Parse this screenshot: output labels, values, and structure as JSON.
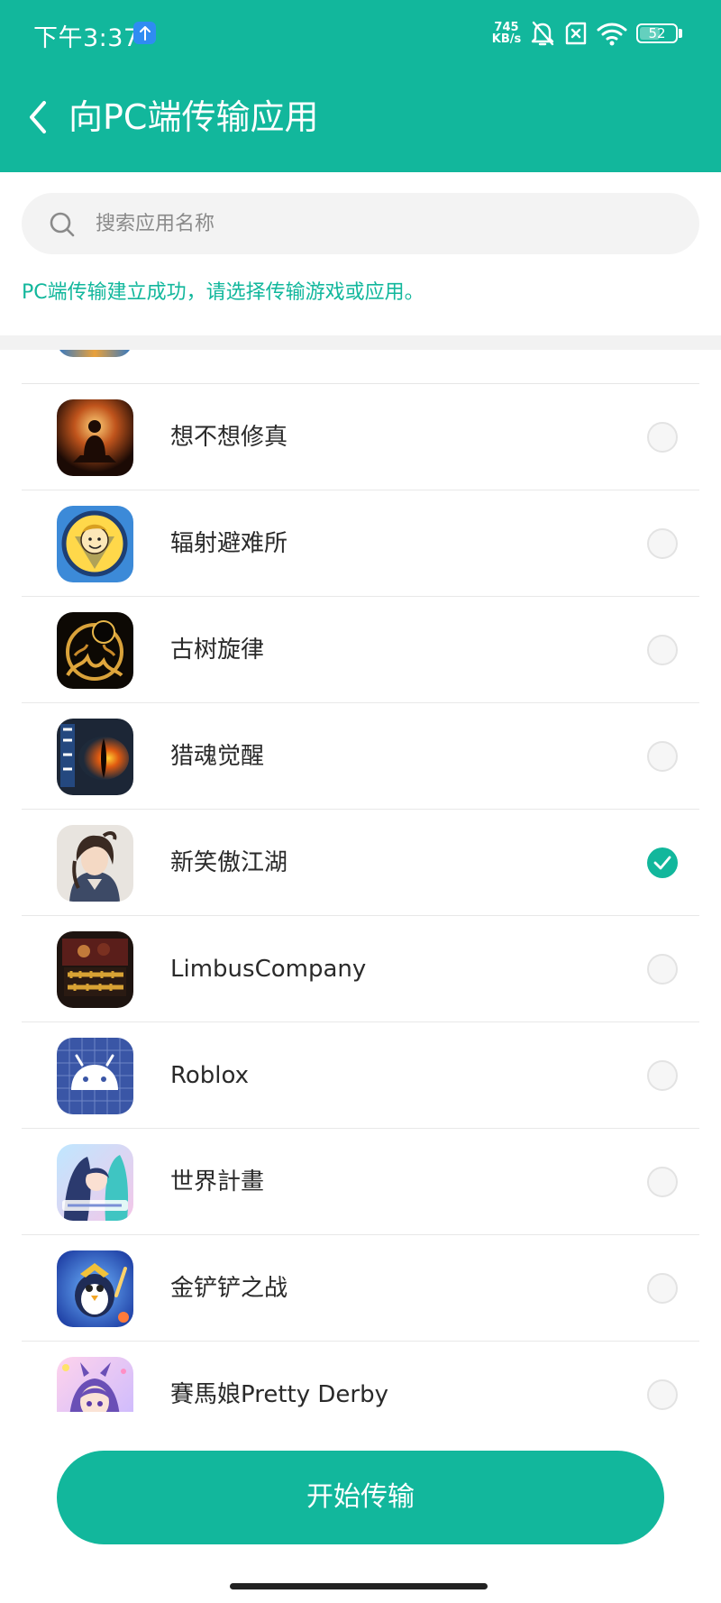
{
  "status_bar": {
    "time": "下午3:37",
    "network_speed_value": "745",
    "network_speed_unit": "KB/s",
    "battery_level": "52",
    "icons": [
      "upload-badge-icon",
      "bell-muted-icon",
      "sim-off-icon",
      "wifi-icon",
      "battery-icon"
    ]
  },
  "header": {
    "back_icon": "chevron-left-icon",
    "title": "向PC端传输应用"
  },
  "search": {
    "icon": "search-icon",
    "placeholder": "搜索应用名称"
  },
  "notice": "PC端传输建立成功，请选择传输游戏或应用。",
  "apps": [
    {
      "name": "想不想修真",
      "selected": false,
      "icon": "meditating-cultivator-icon"
    },
    {
      "name": "辐射避难所",
      "selected": false,
      "icon": "vault-boy-icon"
    },
    {
      "name": "古树旋律",
      "selected": false,
      "icon": "ancient-tree-icon"
    },
    {
      "name": "猎魂觉醒",
      "selected": false,
      "icon": "dragon-eye-icon"
    },
    {
      "name": "新笑傲江湖",
      "selected": true,
      "icon": "swordsman-portrait-icon"
    },
    {
      "name": "LimbusCompany",
      "selected": false,
      "icon": "limbus-company-icon"
    },
    {
      "name": "Roblox",
      "selected": false,
      "icon": "android-robot-icon"
    },
    {
      "name": "世界計畫",
      "selected": false,
      "icon": "project-sekai-icon"
    },
    {
      "name": "金铲铲之战",
      "selected": false,
      "icon": "penguin-icon"
    },
    {
      "name": "賽馬娘Pretty Derby",
      "selected": false,
      "icon": "uma-musume-icon"
    }
  ],
  "start_button": "开始传输",
  "colors": {
    "accent": "#12b79c",
    "search_bg": "#f3f3f3",
    "notice_text": "#12b79c"
  }
}
